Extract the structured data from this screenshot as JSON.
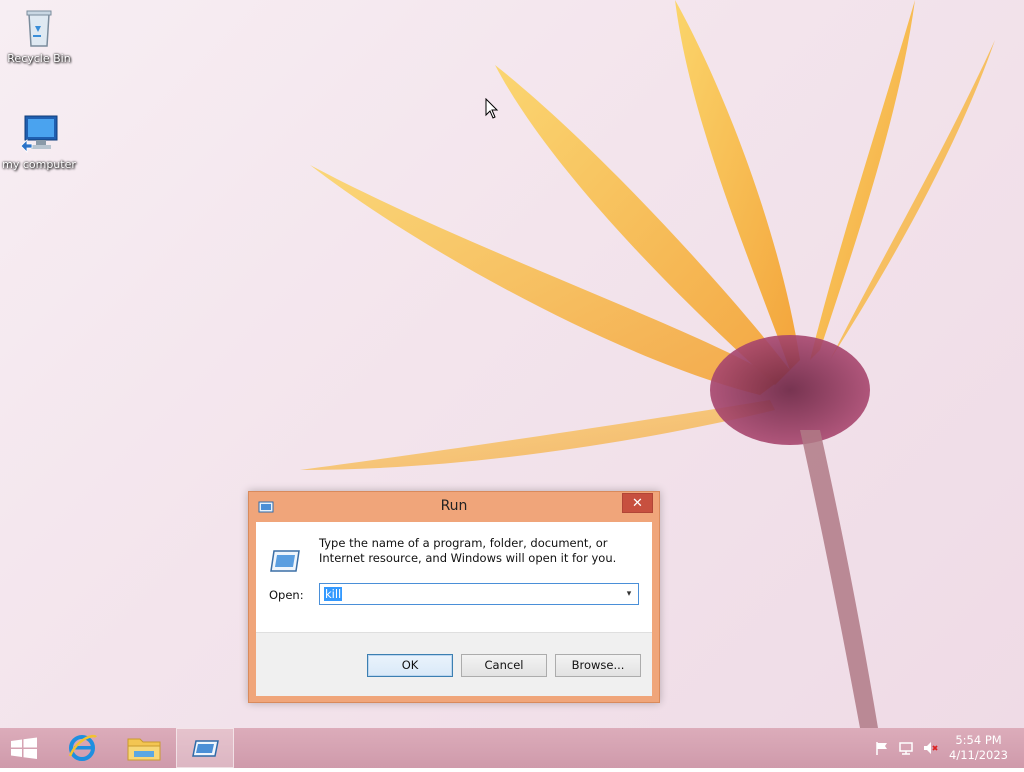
{
  "desktop": {
    "icons": [
      {
        "label": "Recycle Bin",
        "icon": "recycle-bin-icon"
      },
      {
        "label": "my computer",
        "icon": "computer-icon"
      }
    ]
  },
  "run_dialog": {
    "title": "Run",
    "close_glyph": "✕",
    "description": "Type the name of a program, folder, document, or Internet resource, and Windows will open it for you.",
    "open_label": "Open:",
    "open_value": "kill",
    "dropdown_glyph": "▾",
    "buttons": {
      "ok": "OK",
      "cancel": "Cancel",
      "browse": "Browse..."
    }
  },
  "taskbar": {
    "items": [
      {
        "name": "start",
        "icon": "windows-logo-icon"
      },
      {
        "name": "internet-explorer",
        "icon": "internet-explorer-icon"
      },
      {
        "name": "file-explorer",
        "icon": "folder-icon"
      },
      {
        "name": "run",
        "icon": "run-icon"
      }
    ],
    "tray": {
      "icons": [
        "flag-icon",
        "network-icon",
        "volume-muted-icon"
      ]
    },
    "clock": {
      "time": "5:54 PM",
      "date": "4/11/2023"
    }
  },
  "colors": {
    "dialog_frame": "#f0a57a",
    "close_button": "#c7503f",
    "taskbar": "#d6a3b3",
    "selection": "#3399ff"
  }
}
